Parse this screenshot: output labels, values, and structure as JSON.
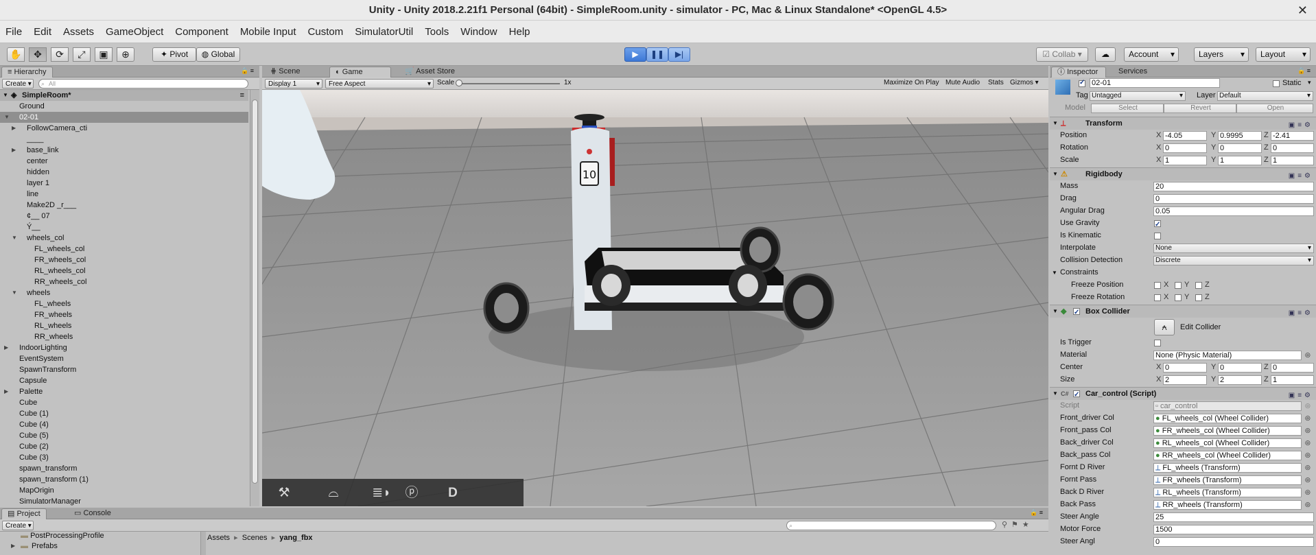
{
  "window": {
    "title": "Unity - Unity 2018.2.21f1 Personal (64bit) - SimpleRoom.unity - simulator - PC, Mac & Linux Standalone* <OpenGL 4.5>"
  },
  "menu": [
    "File",
    "Edit",
    "Assets",
    "GameObject",
    "Component",
    "Mobile Input",
    "Custom",
    "SimulatorUtil",
    "Tools",
    "Window",
    "Help"
  ],
  "toolbar": {
    "pivot": "Pivot",
    "global": "Global",
    "collab": "Collab",
    "account": "Account",
    "layers": "Layers",
    "layout": "Layout"
  },
  "hierarchy": {
    "tab": "Hierarchy",
    "create": "Create",
    "search_placeholder": "All",
    "scene": "SimpleRoom*",
    "items": [
      {
        "label": "Ground",
        "depth": 0,
        "arrow": ""
      },
      {
        "label": "02-01",
        "depth": 0,
        "arrow": "open",
        "selected": true
      },
      {
        "label": "FollowCamera_cti",
        "depth": 1,
        "arrow": "closed"
      },
      {
        "label": "____",
        "depth": 1,
        "arrow": ""
      },
      {
        "label": "base_link",
        "depth": 1,
        "arrow": "closed"
      },
      {
        "label": "center",
        "depth": 1,
        "arrow": ""
      },
      {
        "label": "hidden",
        "depth": 1,
        "arrow": ""
      },
      {
        "label": "layer 1",
        "depth": 1,
        "arrow": ""
      },
      {
        "label": "line",
        "depth": 1,
        "arrow": ""
      },
      {
        "label": "Make2D _r___",
        "depth": 1,
        "arrow": ""
      },
      {
        "label": "¢__ 07",
        "depth": 1,
        "arrow": ""
      },
      {
        "label": "Ý__",
        "depth": 1,
        "arrow": ""
      },
      {
        "label": "wheels_col",
        "depth": 1,
        "arrow": "open"
      },
      {
        "label": "FL_wheels_col",
        "depth": 2,
        "arrow": ""
      },
      {
        "label": "FR_wheels_col",
        "depth": 2,
        "arrow": ""
      },
      {
        "label": "RL_wheels_col",
        "depth": 2,
        "arrow": ""
      },
      {
        "label": "RR_wheels_col",
        "depth": 2,
        "arrow": ""
      },
      {
        "label": "wheels",
        "depth": 1,
        "arrow": "open"
      },
      {
        "label": "FL_wheels",
        "depth": 2,
        "arrow": ""
      },
      {
        "label": "FR_wheels",
        "depth": 2,
        "arrow": ""
      },
      {
        "label": "RL_wheels",
        "depth": 2,
        "arrow": ""
      },
      {
        "label": "RR_wheels",
        "depth": 2,
        "arrow": ""
      },
      {
        "label": "IndoorLighting",
        "depth": 0,
        "arrow": "closed"
      },
      {
        "label": "EventSystem",
        "depth": 0,
        "arrow": ""
      },
      {
        "label": "SpawnTransform",
        "depth": 0,
        "arrow": ""
      },
      {
        "label": "Capsule",
        "depth": 0,
        "arrow": ""
      },
      {
        "label": "Palette",
        "depth": 0,
        "arrow": "closed"
      },
      {
        "label": "Cube",
        "depth": 0,
        "arrow": ""
      },
      {
        "label": "Cube (1)",
        "depth": 0,
        "arrow": ""
      },
      {
        "label": "Cube (4)",
        "depth": 0,
        "arrow": ""
      },
      {
        "label": "Cube (5)",
        "depth": 0,
        "arrow": ""
      },
      {
        "label": "Cube (2)",
        "depth": 0,
        "arrow": ""
      },
      {
        "label": "Cube (3)",
        "depth": 0,
        "arrow": ""
      },
      {
        "label": "spawn_transform",
        "depth": 0,
        "arrow": ""
      },
      {
        "label": "spawn_transform (1)",
        "depth": 0,
        "arrow": ""
      },
      {
        "label": "MapOrigin",
        "depth": 0,
        "arrow": ""
      },
      {
        "label": "SimulatorManager",
        "depth": 0,
        "arrow": ""
      }
    ]
  },
  "game": {
    "tabs": [
      "Scene",
      "Game",
      "Asset Store"
    ],
    "display": "Display 1",
    "aspect": "Free Aspect",
    "scale_label": "Scale",
    "scale_value": "1x",
    "options": [
      "Maximize On Play",
      "Mute Audio",
      "Stats",
      "Gizmos"
    ],
    "robot_number": "10",
    "overlay_buttons": [
      "wrench-icon",
      "wiper-icon",
      "headlight-icon",
      "parking-icon",
      "D"
    ]
  },
  "project": {
    "tabs": [
      "Project",
      "Console"
    ],
    "create": "Create",
    "folders": [
      "PostProcessingProfile",
      "Prefabs"
    ],
    "breadcrumb": [
      "Assets",
      "Scenes",
      "yang_fbx"
    ]
  },
  "inspector": {
    "tabs": [
      "Inspector",
      "Services"
    ],
    "name": "02-01",
    "static": "Static",
    "tag_label": "Tag",
    "tag": "Untagged",
    "layer_label": "Layer",
    "layer": "Default",
    "model_label": "Model",
    "model_buttons": [
      "Select",
      "Revert",
      "Open"
    ],
    "transform": {
      "title": "Transform",
      "rows": [
        {
          "label": "Position",
          "x": "-4.05",
          "y": "0.9995",
          "z": "-2.41"
        },
        {
          "label": "Rotation",
          "x": "0",
          "y": "0",
          "z": "0"
        },
        {
          "label": "Scale",
          "x": "1",
          "y": "1",
          "z": "1"
        }
      ]
    },
    "rigidbody": {
      "title": "Rigidbody",
      "mass_label": "Mass",
      "mass": "20",
      "drag_label": "Drag",
      "drag": "0",
      "angular_label": "Angular Drag",
      "angular": "0.05",
      "gravity_label": "Use Gravity",
      "kinematic_label": "Is Kinematic",
      "interpolate_label": "Interpolate",
      "interpolate": "None",
      "collision_label": "Collision Detection",
      "collision": "Discrete",
      "constraints_label": "Constraints",
      "freeze_pos_label": "Freeze Position",
      "freeze_rot_label": "Freeze Rotation",
      "axes": [
        "X",
        "Y",
        "Z"
      ]
    },
    "box_collider": {
      "title": "Box Collider",
      "edit": "Edit Collider",
      "trigger_label": "Is Trigger",
      "material_label": "Material",
      "material": "None (Physic Material)",
      "center_label": "Center",
      "center": {
        "x": "0",
        "y": "0",
        "z": "0"
      },
      "size_label": "Size",
      "size": {
        "x": "2",
        "y": "2",
        "z": "1"
      }
    },
    "car_control": {
      "title": "Car_control (Script)",
      "script_label": "Script",
      "script": "car_control",
      "rows": [
        {
          "label": "Front_driver Col",
          "value": "FL_wheels_col (Wheel Collider)",
          "kind": "col"
        },
        {
          "label": "Front_pass Col",
          "value": "FR_wheels_col (Wheel Collider)",
          "kind": "col"
        },
        {
          "label": "Back_driver Col",
          "value": "RL_wheels_col (Wheel Collider)",
          "kind": "col"
        },
        {
          "label": "Back_pass Col",
          "value": "RR_wheels_col (Wheel Collider)",
          "kind": "col"
        },
        {
          "label": "Fornt D River",
          "value": "FL_wheels (Transform)",
          "kind": "tr"
        },
        {
          "label": "Fornt Pass",
          "value": "FR_wheels (Transform)",
          "kind": "tr"
        },
        {
          "label": "Back D River",
          "value": "RL_wheels (Transform)",
          "kind": "tr"
        },
        {
          "label": "Back Pass",
          "value": "RR_wheels (Transform)",
          "kind": "tr"
        }
      ],
      "steer_label": "Steer Angle",
      "steer": "25",
      "motor_label": "Motor Force",
      "motor": "1500",
      "steer2_label": "Steer Angl",
      "steer2": "0"
    }
  }
}
